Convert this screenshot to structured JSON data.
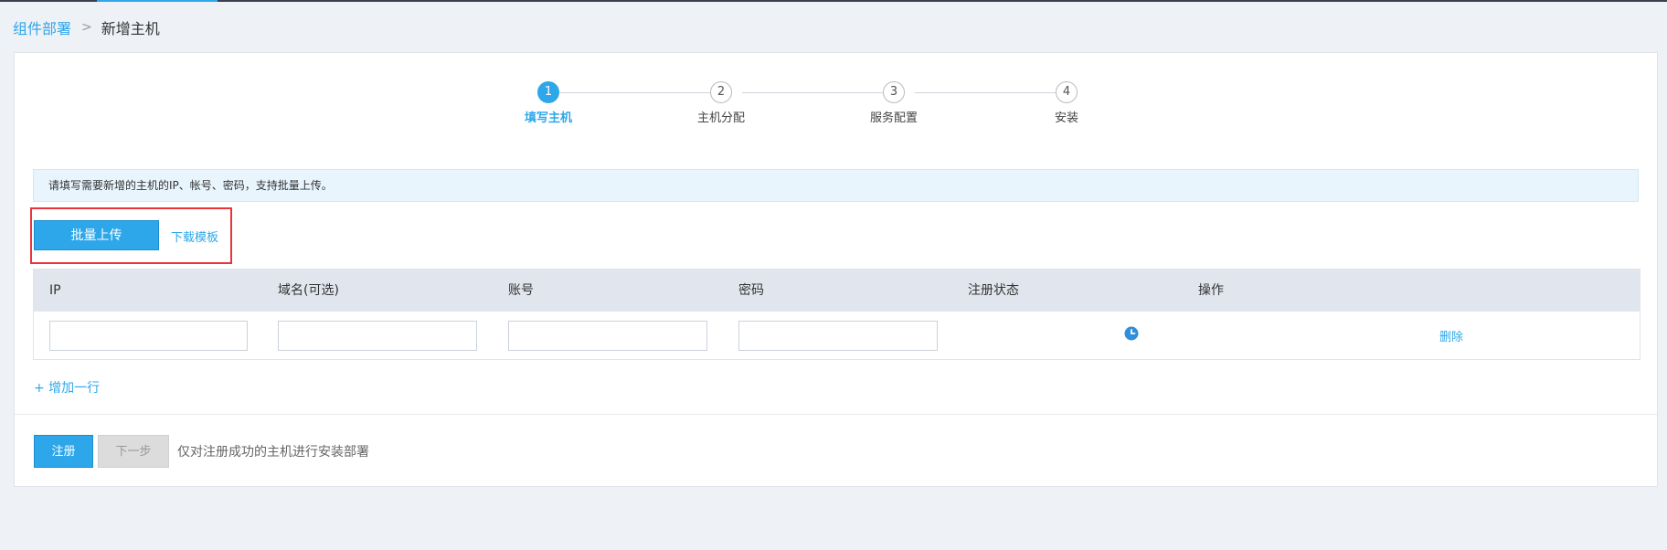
{
  "breadcrumb": {
    "parent": "组件部署",
    "separator": ">",
    "current": "新增主机"
  },
  "steps": [
    {
      "number": "1",
      "label": "填写主机",
      "active": true
    },
    {
      "number": "2",
      "label": "主机分配",
      "active": false
    },
    {
      "number": "3",
      "label": "服务配置",
      "active": false
    },
    {
      "number": "4",
      "label": "安装",
      "active": false
    }
  ],
  "notice": "请填写需要新增的主机的IP、帐号、密码，支持批量上传。",
  "actions": {
    "batch_upload": "批量上传",
    "download_template": "下载模板"
  },
  "table": {
    "headers": [
      "IP",
      "域名(可选)",
      "账号",
      "密码",
      "注册状态",
      "操作"
    ],
    "rows": [
      {
        "ip": "",
        "domain": "",
        "account": "",
        "password": "",
        "status_icon": "clock-icon",
        "action": "删除"
      }
    ]
  },
  "add_row": "+ 增加一行",
  "footer": {
    "register": "注册",
    "next": "下一步",
    "hint": "仅对注册成功的主机进行安装部署"
  },
  "colors": {
    "accent": "#2ea7ea",
    "highlight": "#e8353b",
    "header_bg": "#e1e6ee",
    "notice_bg": "#e8f5fd"
  }
}
